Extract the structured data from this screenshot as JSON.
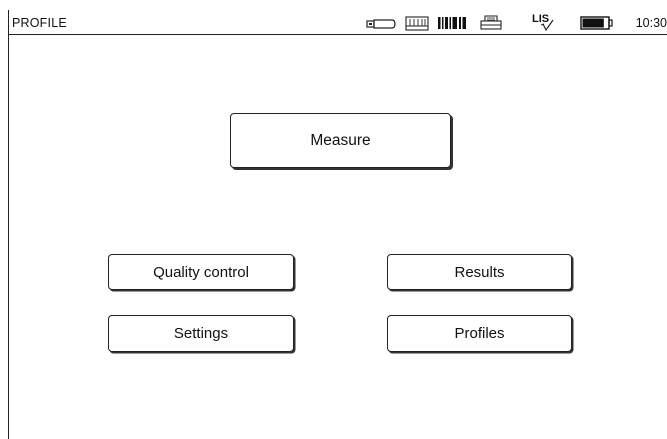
{
  "header": {
    "title": "PROFILE",
    "clock": "10:30",
    "status_icons": [
      "usb-stick-icon",
      "keyboard-icon",
      "barcode-icon",
      "printer-icon",
      "lis-connection-icon",
      "battery-icon"
    ],
    "lis_label": "LIS",
    "battery_level": 0.85
  },
  "main": {
    "measure_label": "Measure",
    "quality_control_label": "Quality control",
    "results_label": "Results",
    "settings_label": "Settings",
    "profiles_label": "Profiles"
  }
}
